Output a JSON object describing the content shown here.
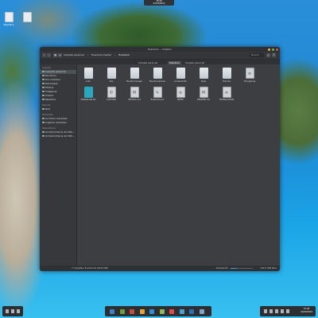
{
  "topbar": {
    "line1": "15:40",
    "line2": "22/03/2024"
  },
  "desktop": {
    "icons": [
      {
        "label": "Papelera"
      },
      {
        "label": ""
      }
    ]
  },
  "window": {
    "title": "fluentum — Dolphin",
    "breadcrumbs": [
      "Carpeta personal",
      "fluentum-master",
      "fluentum"
    ],
    "search_placeholder": "Buscar",
    "tabs": [
      "Carpeta personal",
      "fluentum",
      "Carpeta personal"
    ],
    "sidebar": {
      "sections": [
        {
          "title": "Lugares",
          "items": [
            "Carpeta personal",
            "Escritorio",
            "Documentos",
            "Descargas",
            "Música",
            "Imágenes",
            "Vídeos",
            "Papelera"
          ]
        },
        {
          "title": "Remoto",
          "items": [
            "Red"
          ]
        },
        {
          "title": "Recientes",
          "items": [
            "Archivos recientes",
            "Lugares recientes"
          ]
        },
        {
          "title": "Dispositivos",
          "items": [
            "Unidad interna de 500...",
            "Unidad interna de 500..."
          ]
        }
      ]
    },
    "files": [
      {
        "name": "color",
        "type": "folder"
      },
      {
        "name": "dbs",
        "type": "folder"
      },
      {
        "name": "fluentumanager",
        "type": "folder"
      },
      {
        "name": "fluentumpreview",
        "type": "folder"
      },
      {
        "name": "screenshots",
        "type": "folder"
      },
      {
        "name": "style",
        "type": "folder"
      },
      {
        "name": "themes",
        "type": "folder"
      },
      {
        "name": "ChangeLog",
        "type": "doc"
      },
      {
        "name": "CMakeLists.txt",
        "type": "teal"
      },
      {
        "name": "COPYING",
        "type": "doc"
      },
      {
        "name": "INSTALL.md",
        "type": "doc"
      },
      {
        "name": "fluentum.pro",
        "type": "doc"
      },
      {
        "name": "NEWS",
        "type": "doc"
      },
      {
        "name": "README.md",
        "type": "doc"
      },
      {
        "name": "TRANSLATION",
        "type": "doc"
      }
    ],
    "status": {
      "summary": "7 carpetas, 8 archivos (22,6 KiB)",
      "zoom_label": "Ampliación:",
      "zoom_level": 0.3,
      "free_space": "122,4 GiB libre"
    }
  },
  "taskbar": {
    "dock_colors": [
      "#3b82c4",
      "#6f9c3a",
      "#c94a3a",
      "#e2a23b",
      "#2d8fd8",
      "#8bb85a",
      "#e04848",
      "#4a9fd6",
      "#2c6fb0",
      "#7aa6c9"
    ],
    "clock": {
      "time": "15:40",
      "date": "22/03/2024"
    }
  }
}
